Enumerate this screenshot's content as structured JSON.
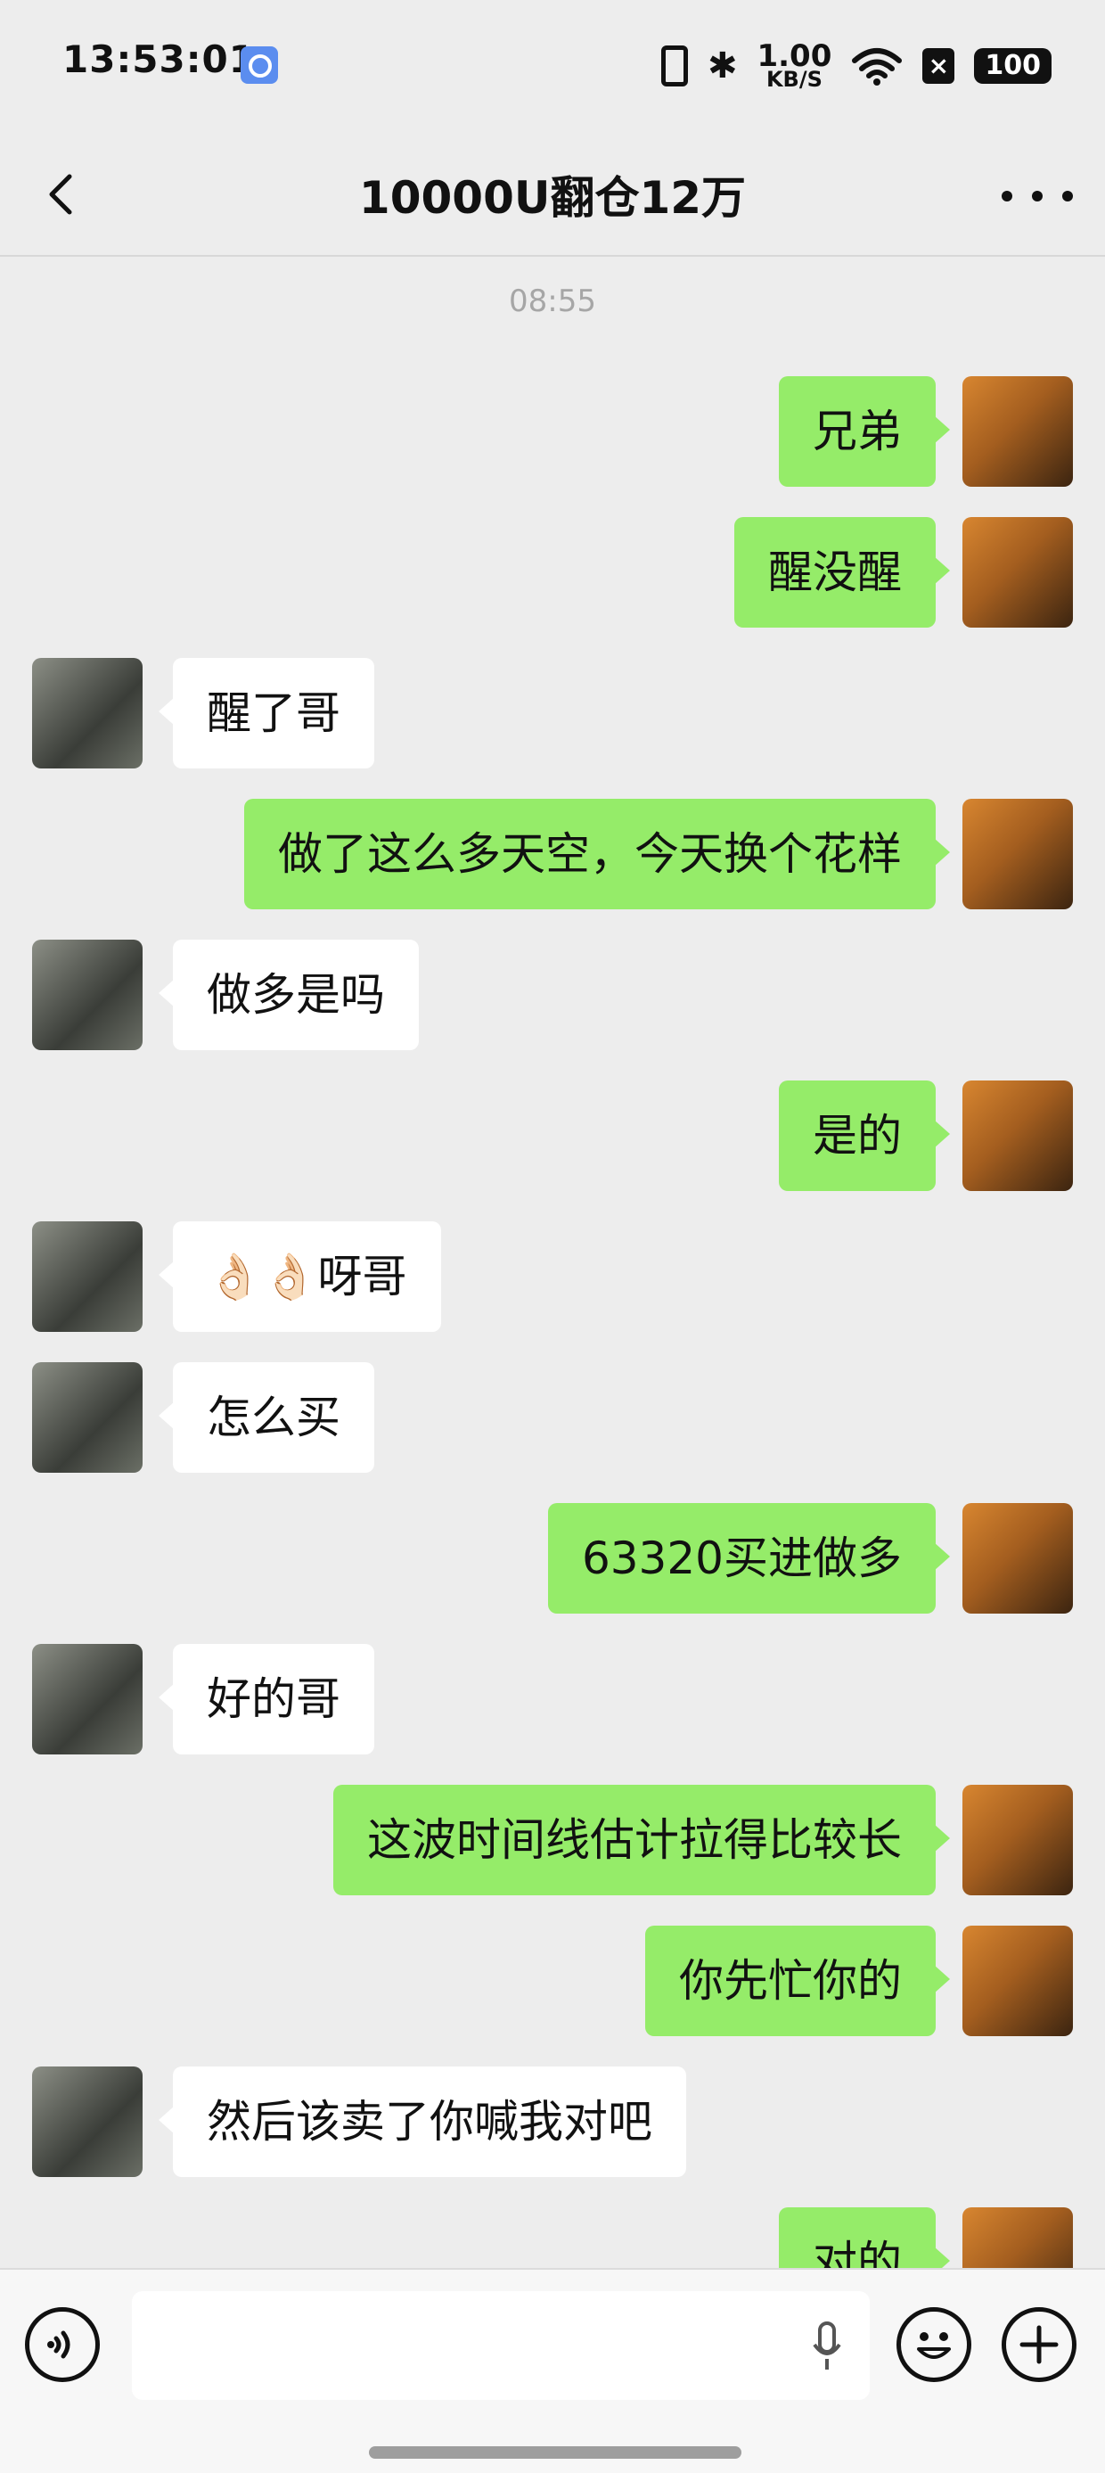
{
  "status_bar": {
    "time": "13:53:01",
    "net_speed_value": "1.00",
    "net_speed_unit": "KB/S",
    "battery": "100",
    "icons": [
      "app-notification-icon",
      "vibrate-icon",
      "bluetooth-icon",
      "wifi-icon",
      "close-box-icon",
      "battery-icon"
    ]
  },
  "nav": {
    "title": "10000U翻仓12万",
    "back_icon": "chevron-left-icon",
    "more_icon": "more-dots-icon"
  },
  "chat": {
    "timestamp": "08:55",
    "messages": [
      {
        "side": "out",
        "text": "兄弟"
      },
      {
        "side": "out",
        "text": "醒没醒"
      },
      {
        "side": "in",
        "text": "醒了哥"
      },
      {
        "side": "out",
        "text": "做了这么多天空，今天换个花样"
      },
      {
        "side": "in",
        "text": "做多是吗"
      },
      {
        "side": "out",
        "text": "是的"
      },
      {
        "side": "in",
        "text": "👌🏻👌🏻呀哥"
      },
      {
        "side": "in",
        "text": "怎么买"
      },
      {
        "side": "out",
        "text": "63320买进做多"
      },
      {
        "side": "in",
        "text": "好的哥"
      },
      {
        "side": "out",
        "text": "这波时间线估计拉得比较长"
      },
      {
        "side": "out",
        "text": "你先忙你的"
      },
      {
        "side": "in",
        "text": "然后该卖了你喊我对吧"
      },
      {
        "side": "out",
        "text": "对的"
      }
    ]
  },
  "input_bar": {
    "voice_icon": "voice-toggle-icon",
    "mic_icon": "microphone-icon",
    "emoji_icon": "emoji-icon",
    "plus_icon": "plus-icon",
    "value": ""
  },
  "colors": {
    "background": "#ededed",
    "outgoing_bubble": "#95ec69",
    "incoming_bubble": "#ffffff",
    "timestamp": "#a6a6a6"
  }
}
